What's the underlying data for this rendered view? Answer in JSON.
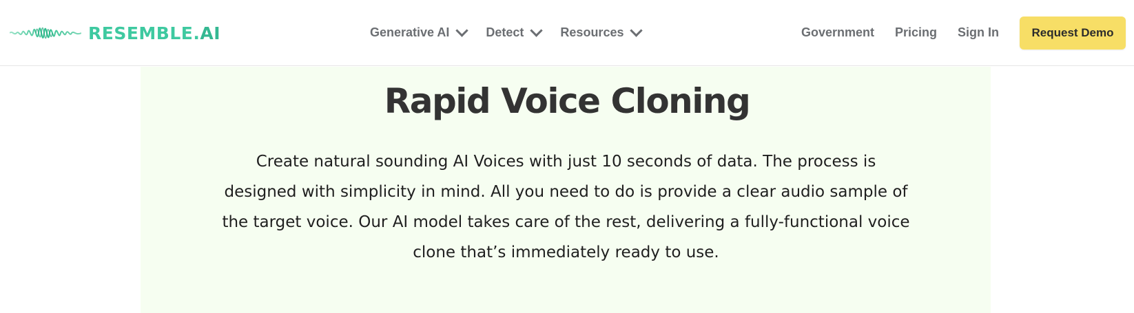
{
  "brand": {
    "logo_text_main": "RESEMBLE.",
    "logo_text_suffix": "AI",
    "accent_color": "#3ec9a0"
  },
  "nav": {
    "menu": [
      {
        "label": "Generative AI",
        "icon": "chevron-down-icon"
      },
      {
        "label": "Detect",
        "icon": "chevron-down-icon"
      },
      {
        "label": "Resources",
        "icon": "chevron-down-icon"
      }
    ],
    "links": {
      "government": "Government",
      "pricing": "Pricing",
      "sign_in": "Sign In"
    },
    "cta": {
      "label": "Request Demo",
      "color": "#f7de66"
    }
  },
  "hero": {
    "title": "Rapid Voice Cloning",
    "description": "Create natural sounding AI Voices with just 10 seconds of data. The process is designed with simplicity in mind. All you need to do is provide a clear audio sample of the target voice. Our AI model takes care of the rest, delivering a fully-functional voice clone that’s immediately ready to use.",
    "background_color": "#f6fef1"
  }
}
